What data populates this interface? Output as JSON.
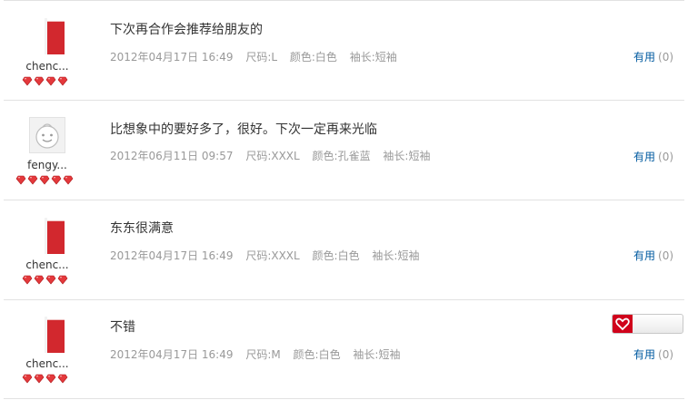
{
  "reviews": [
    {
      "username": "chenc...",
      "comment": "下次再合作会推荐给朋友的",
      "date": "2012年04月17日 16:49",
      "size": "尺码:L",
      "color": "颜色:白色",
      "sleeve": "袖长:短袖",
      "useful_label": "有用",
      "useful_count": "(0)",
      "avatar": "red-tshirt-avatar",
      "rank_icons": 4
    },
    {
      "username": "fengy...",
      "comment": "比想象中的要好多了，很好。下次一定再来光临",
      "date": "2012年06月11日 09:57",
      "size": "尺码:XXXL",
      "color": "颜色:孔雀蓝",
      "sleeve": "袖长:短袖",
      "useful_label": "有用",
      "useful_count": "(0)",
      "avatar": "default-face-avatar",
      "rank_icons": 5
    },
    {
      "username": "chenc...",
      "comment": "东东很满意",
      "date": "2012年04月17日 16:49",
      "size": "尺码:XXXL",
      "color": "颜色:白色",
      "sleeve": "袖长:短袖",
      "useful_label": "有用",
      "useful_count": "(0)",
      "avatar": "red-tshirt-avatar",
      "rank_icons": 4
    },
    {
      "username": "chenc...",
      "comment": "不错",
      "date": "2012年04月17日 16:49",
      "size": "尺码:M",
      "color": "颜色:白色",
      "sleeve": "袖长:短袖",
      "useful_label": "有用",
      "useful_count": "(0)",
      "avatar": "red-tshirt-avatar",
      "rank_icons": 4
    }
  ],
  "colors": {
    "link_blue": "#005aa0",
    "meta_gray": "#999999",
    "rank_red": "#e4393c",
    "share_red": "#d0021b"
  },
  "share_widget": {
    "icon": "heart-share-icon"
  }
}
